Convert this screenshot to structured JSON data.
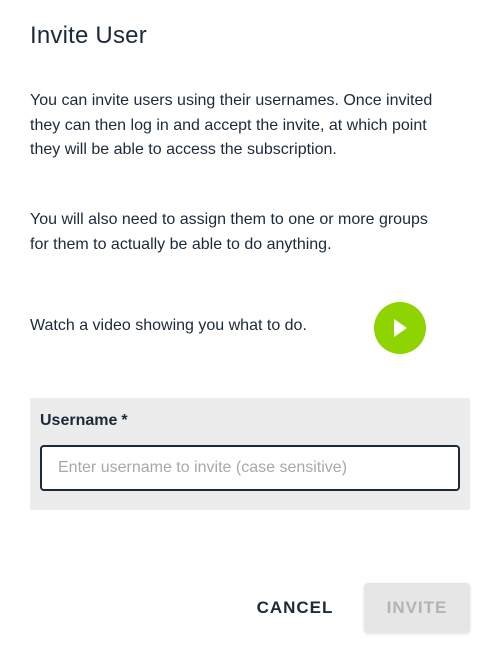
{
  "dialog": {
    "title": "Invite User",
    "paragraph_1": "You can invite users using their usernames. Once invited they can then log in and accept the invite, at which point they will be able to access the subscription.",
    "paragraph_2": "You will also need to assign them to one or more groups for them to actually be able to do anything.",
    "video": {
      "text": "Watch a video showing you what to do.",
      "icon": "play-icon",
      "button_color": "#8fd400"
    },
    "username_field": {
      "label": "Username",
      "required_marker": "*",
      "value": "",
      "placeholder": "Enter username to invite (case sensitive)"
    },
    "actions": {
      "cancel_label": "CANCEL",
      "invite_label": "INVITE",
      "invite_disabled": true
    }
  },
  "colors": {
    "text": "#1b2a3a",
    "accent": "#8fd400",
    "panel": "#ececec",
    "disabled_text": "#b3b3b3"
  }
}
